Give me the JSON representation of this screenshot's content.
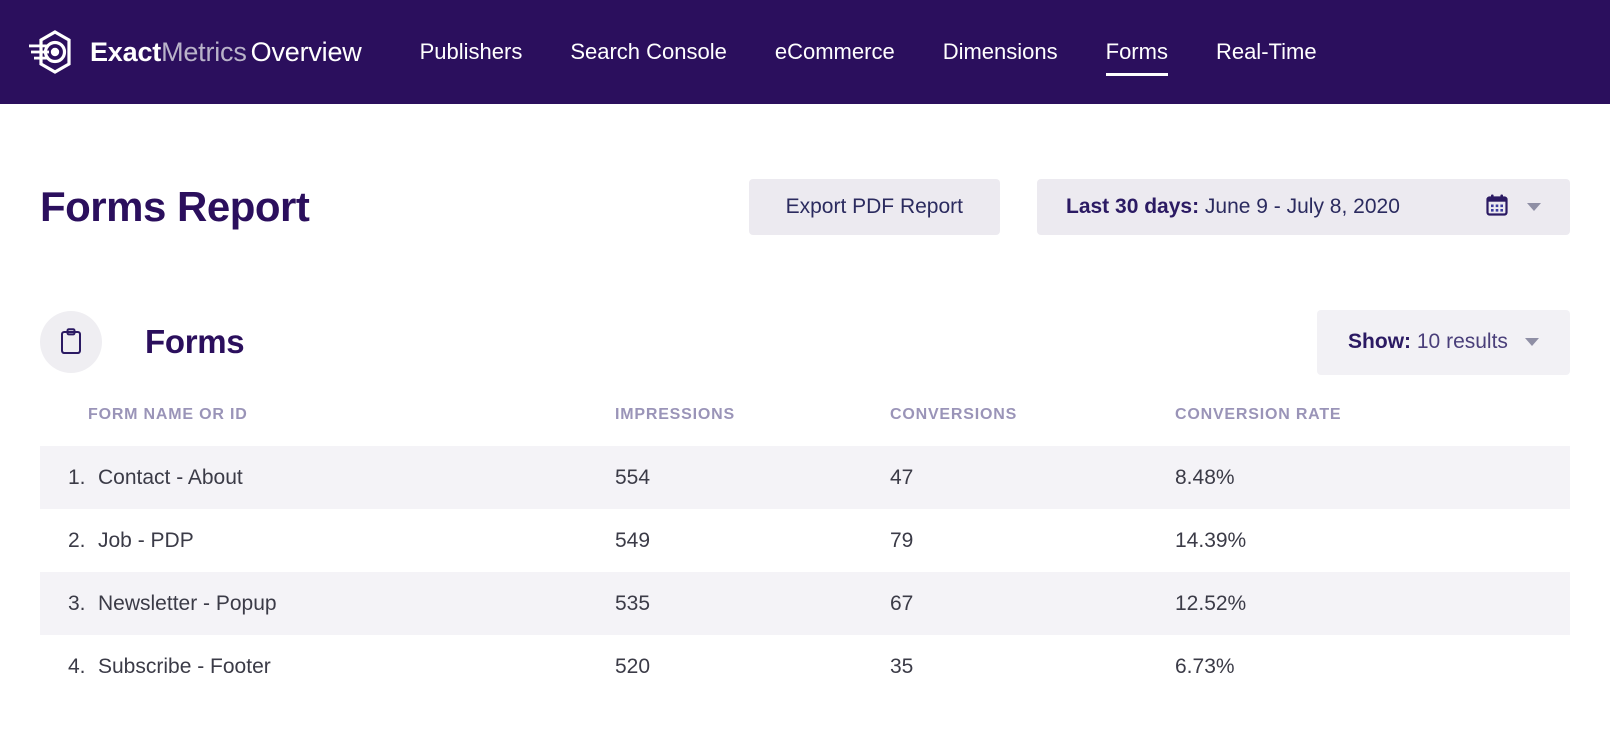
{
  "navbar": {
    "logo_icon": "exactmetrics-hexagon-logo",
    "brand": {
      "part1": "Exact",
      "part2": "Metrics",
      "part3": "Overview"
    },
    "items": [
      {
        "label": "Publishers",
        "active": false
      },
      {
        "label": "Search Console",
        "active": false
      },
      {
        "label": "eCommerce",
        "active": false
      },
      {
        "label": "Dimensions",
        "active": false
      },
      {
        "label": "Forms",
        "active": true
      },
      {
        "label": "Real-Time",
        "active": false
      }
    ],
    "background": "#2b0f5d"
  },
  "header": {
    "title": "Forms Report",
    "export_button": "Export PDF Report",
    "date_range": {
      "label": "Last 30 days:",
      "value": " June 9 - July 8, 2020"
    },
    "calendar_icon": "calendar-icon",
    "chevron_icon": "chevron-down-icon"
  },
  "card": {
    "icon": "clipboard-icon",
    "title": "Forms",
    "show": {
      "label": "Show:",
      "value": " 10 results"
    },
    "show_chevron_icon": "chevron-down-icon",
    "table": {
      "columns": [
        "FORM NAME OR ID",
        "IMPRESSIONS",
        "CONVERSIONS",
        "CONVERSION RATE"
      ],
      "rows": [
        {
          "rank": "1.",
          "name": "Contact - About",
          "impressions": "554",
          "conversions": "47",
          "rate": "8.48%"
        },
        {
          "rank": "2.",
          "name": "Job - PDP",
          "impressions": "549",
          "conversions": "79",
          "rate": "14.39%"
        },
        {
          "rank": "3.",
          "name": "Newsletter - Popup",
          "impressions": "535",
          "conversions": "67",
          "rate": "12.52%"
        },
        {
          "rank": "4.",
          "name": "Subscribe - Footer",
          "impressions": "520",
          "conversions": "35",
          "rate": "6.73%"
        }
      ]
    }
  },
  "colors": {
    "brand_purple": "#2b0f5d",
    "row_stripe": "#f4f3f7",
    "button_bg": "#eceaf0",
    "header_text": "#9a94b8"
  }
}
